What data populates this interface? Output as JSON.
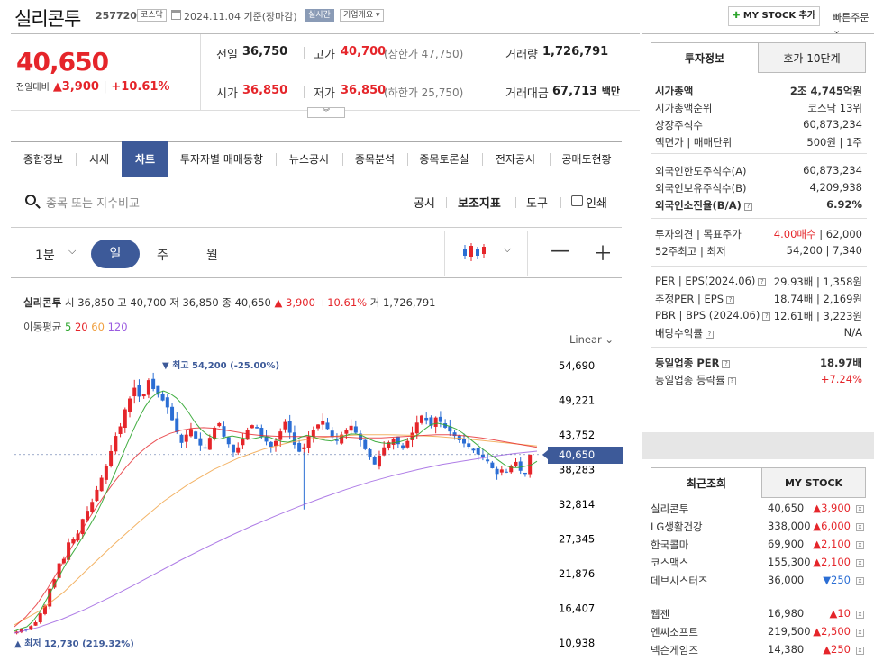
{
  "header": {
    "stock_name": "실리콘투",
    "stock_code": "257720",
    "market": "코스닥",
    "date": "2024.11.04 기준(장마감)",
    "realtime": "실시간",
    "company_info": "기업개요 ▾",
    "mystock_add": "MY STOCK 추가",
    "quick_order": "빠른주문 ⌄"
  },
  "summary": {
    "price": "40,650",
    "change_label": "전일대비",
    "change": "▲3,900",
    "change_pct": "+10.61%",
    "prev_close_label": "전일",
    "prev_close": "36,750",
    "high_label": "고가",
    "high": "40,700",
    "upper_limit": "(상한가 47,750)",
    "volume_label": "거래량",
    "volume": "1,726,791",
    "open_label": "시가",
    "open": "36,850",
    "low_label": "저가",
    "low": "36,850",
    "lower_limit": "(하한가 25,750)",
    "amount_label": "거래대금",
    "amount": "67,713",
    "amount_unit": "백만"
  },
  "tabs": [
    "종합정보",
    "시세",
    "차트",
    "투자자별 매매동향",
    "뉴스공시",
    "종목분석",
    "종목토론실",
    "전자공시",
    "공매도현황"
  ],
  "toolbar": {
    "search_placeholder": "종목 또는 지수비교",
    "disclosure": "공시",
    "indicator": "보조지표",
    "tools": "도구",
    "print": "인쇄"
  },
  "period": {
    "minute": "1분",
    "day": "일",
    "week": "주",
    "month": "월"
  },
  "chart_header": {
    "name": "실리콘투",
    "ohlc": "시 36,850 고 40,700 저 36,850 종 40,650",
    "change": "▲ 3,900 +10.61%",
    "volume": "거 1,726,791",
    "ma_label": "이동평균",
    "ma5": "5",
    "ma20": "20",
    "ma60": "60",
    "ma120": "120",
    "scale": "Linear ⌄",
    "high_marker": "▼ 최고 54,200 (-25.00%)",
    "low_marker": "▲ 최저 12,730 (219.32%)",
    "current_flag": "40,650"
  },
  "chart_data": {
    "type": "candlestick",
    "y_ticks": [
      "54,690",
      "49,221",
      "43,752",
      "38,283",
      "32,814",
      "27,345",
      "21,876",
      "16,407",
      "10,938"
    ],
    "ylim": [
      10938,
      54690
    ],
    "current": 40650,
    "high": 54200,
    "low": 12730,
    "close_series": [
      12730,
      13200,
      13000,
      13600,
      14200,
      15600,
      16800,
      19500,
      21000,
      23500,
      24200,
      26800,
      27300,
      28200,
      30500,
      31800,
      33200,
      35100,
      37000,
      38800,
      41200,
      43600,
      45100,
      47800,
      49500,
      51200,
      49800,
      50200,
      52400,
      51000,
      50100,
      49200,
      48100,
      46100,
      44200,
      42500,
      43800,
      44700,
      43200,
      42100,
      41600,
      43300,
      44900,
      45600,
      43500,
      42300,
      41000,
      41800,
      43200,
      44500,
      45300,
      44800,
      43500,
      42700,
      41900,
      42800,
      44300,
      45800,
      44100,
      42200,
      41100,
      41800,
      43500,
      44600,
      45400,
      46000,
      44700,
      43400,
      42800,
      43800,
      44600,
      45200,
      44100,
      42900,
      41500,
      40200,
      39100,
      40500,
      41800,
      42600,
      43200,
      42300,
      41600,
      42800,
      44100,
      45700,
      46800,
      46100,
      45200,
      46500,
      45800,
      44900,
      44300,
      43600,
      42900,
      42400,
      41900,
      41300,
      40700,
      40200,
      39600,
      38500,
      37600,
      38300,
      37900,
      38800,
      39500,
      38100,
      37600,
      40650
    ],
    "ma5": [
      12800,
      13200,
      13500,
      14400,
      15700,
      17500,
      19300,
      21100,
      22900,
      24600,
      26100,
      27700,
      29300,
      31000,
      33000,
      35200,
      37400,
      39700,
      42100,
      44300,
      46400,
      48200,
      49600,
      50400,
      50700,
      50300,
      49600,
      48600,
      47300,
      45800,
      44600,
      43800,
      43300,
      43100,
      43400,
      43600,
      43400,
      43200,
      43100,
      43300,
      43500,
      43400,
      43000,
      42700,
      42600,
      42900,
      43400,
      43700,
      43500,
      43100,
      42900,
      42800,
      43100,
      43600,
      43900,
      43900,
      43600,
      43100,
      42700,
      42500,
      42400,
      42500,
      42700,
      43000,
      43300,
      43900,
      44700,
      45400,
      45600,
      45400,
      45100,
      44700,
      44100,
      43300,
      42500,
      41700,
      41000,
      40300,
      39600,
      38900,
      38600,
      38600,
      38800,
      39000,
      39600
    ],
    "ma20": [
      13500,
      15000,
      17000,
      19600,
      22500,
      25600,
      28600,
      31400,
      34000,
      36400,
      38600,
      40500,
      42000,
      43200,
      44000,
      44500,
      44800,
      44900,
      44800,
      44500,
      44200,
      43900,
      43700,
      43600,
      43500,
      43500,
      43500,
      43500,
      43500,
      43500,
      43400,
      43300,
      43300,
      43300,
      43400,
      43500,
      43600,
      43700,
      43800,
      43800,
      43700,
      43500,
      43300,
      43000,
      42700,
      42400,
      42100,
      41800
    ],
    "ma60": [
      13800,
      16000,
      19000,
      22800,
      26500,
      30000,
      33300,
      36000,
      38300,
      40100,
      41500,
      42500,
      43200,
      43600,
      43800,
      43800,
      43700,
      43500,
      43200,
      42800,
      42400,
      42000
    ],
    "ma120": [
      12500,
      13400,
      14700,
      16300,
      18100,
      20000,
      22000,
      24000,
      25900,
      27700,
      29400,
      31000,
      32500,
      33900,
      35200,
      36400,
      37400,
      38300,
      39100,
      39700,
      40300,
      40800,
      41200
    ]
  },
  "right_panel": {
    "tab_invest": "투자정보",
    "tab_orderbook": "호가 10단계",
    "rows1": [
      {
        "label": "시가총액",
        "value": "2조 4,745억원"
      },
      {
        "label": "시가총액순위",
        "value": "코스닥 13위"
      },
      {
        "label": "상장주식수",
        "value": "60,873,234"
      },
      {
        "label": "액면가 | 매매단위",
        "value": "500원 | 1주"
      }
    ],
    "rows2": [
      {
        "label": "외국인한도주식수(A)",
        "value": "60,873,234"
      },
      {
        "label": "외국인보유주식수(B)",
        "value": "4,209,938"
      },
      {
        "label": "외국인소진율(B/A)",
        "value": "6.92%"
      }
    ],
    "rows3": [
      {
        "label": "투자의견 | 목표주가",
        "value_red": "4.00매수",
        "value": " | 62,000"
      },
      {
        "label": "52주최고 | 최저",
        "value": "54,200 | 7,340"
      }
    ],
    "rows4": [
      {
        "label": "PER | EPS(2024.06)",
        "value": "29.93배 | 1,358원"
      },
      {
        "label": "추정PER | EPS",
        "value": "18.74배 | 2,169원"
      },
      {
        "label": "PBR | BPS (2024.06)",
        "value": "12.61배 | 3,223원"
      },
      {
        "label": "배당수익률",
        "value": "N/A"
      }
    ],
    "rows5": [
      {
        "label": "동일업종 PER",
        "value": "18.97배"
      },
      {
        "label": "동일업종 등락률",
        "value": "+7.24%"
      }
    ],
    "tab_recent": "최근조회",
    "tab_mystock": "MY STOCK",
    "history": [
      {
        "name": "실리콘투",
        "price": "40,650",
        "change": "▲3,900",
        "dir": "up"
      },
      {
        "name": "LG생활건강",
        "price": "338,000",
        "change": "▲6,000",
        "dir": "up"
      },
      {
        "name": "한국콜마",
        "price": "69,900",
        "change": "▲2,100",
        "dir": "up"
      },
      {
        "name": "코스맥스",
        "price": "155,300",
        "change": "▲2,100",
        "dir": "up"
      },
      {
        "name": "데브시스터즈",
        "price": "36,000",
        "change": "▼250",
        "dir": "down"
      },
      {
        "name": "웹젠",
        "price": "16,980",
        "change": "▲10",
        "dir": "up"
      },
      {
        "name": "엔씨소프트",
        "price": "219,500",
        "change": "▲2,500",
        "dir": "up"
      },
      {
        "name": "넥슨게임즈",
        "price": "14,380",
        "change": "▲250",
        "dir": "up"
      }
    ],
    "close_x": "x"
  },
  "colors": {
    "accent": "#3d5a99",
    "up": "#e5252a",
    "down": "#2b6ed4",
    "ma5": "#2da52d",
    "ma20": "#e5252a",
    "ma60": "#f0a040",
    "ma120": "#9a5be0"
  }
}
